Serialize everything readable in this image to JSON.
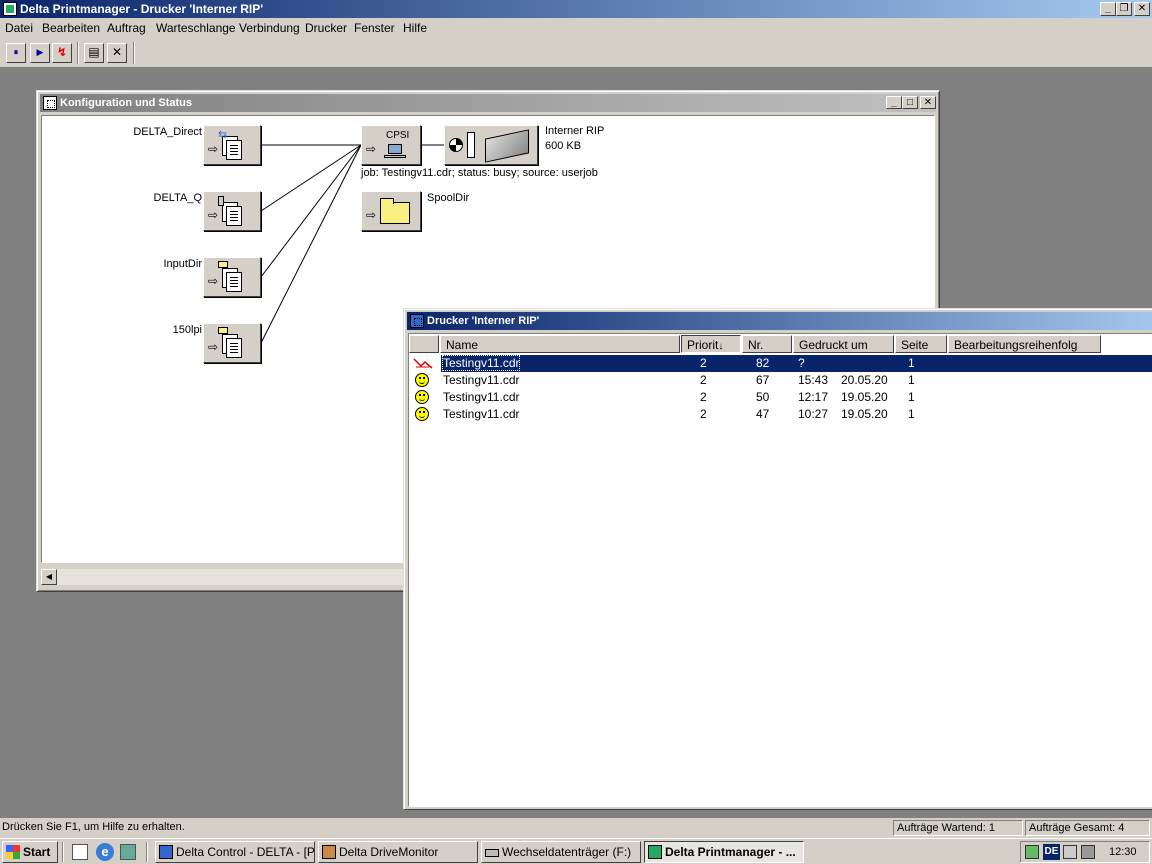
{
  "app": {
    "title": "Delta Printmanager - Drucker 'Interner RIP'"
  },
  "menu": [
    "Datei",
    "Bearbeiten",
    "Auftrag",
    "Warteschlange",
    "Verbindung",
    "Drucker",
    "Fenster",
    "Hilfe"
  ],
  "toolbar": {
    "pause": "⏸",
    "play": "▶",
    "stop": "↯",
    "list": "▤",
    "close": "✕"
  },
  "config_window": {
    "title": "Konfiguration und Status",
    "sources": [
      "DELTA_Direct",
      "DELTA_Q",
      "InputDir",
      "150lpi"
    ],
    "cpsi_label": "CPSI",
    "printer_name": "Interner RIP",
    "printer_memory": "600 KB",
    "job_status": "job: Testingv11.cdr; status: busy; source: userjob",
    "spool_label": "SpoolDir"
  },
  "printer_window": {
    "title": "Drucker 'Interner RIP'",
    "columns": [
      "Name",
      "Priorit",
      "Nr.",
      "Gedruckt um",
      "Seite",
      "Bearbeitungsreihenfolg"
    ],
    "sort_indicator": "↓",
    "jobs": [
      {
        "name": "Testingv11.cdr",
        "prio": "2",
        "nr": "82",
        "time": "?",
        "date": "",
        "page": "1",
        "status_icon": "busy-icon"
      },
      {
        "name": "Testingv11.cdr",
        "prio": "2",
        "nr": "67",
        "time": "15:43",
        "date": "20.05.20",
        "page": "1",
        "status_icon": "smiley-icon"
      },
      {
        "name": "Testingv11.cdr",
        "prio": "2",
        "nr": "50",
        "time": "12:17",
        "date": "19.05.20",
        "page": "1",
        "status_icon": "smiley-icon"
      },
      {
        "name": "Testingv11.cdr",
        "prio": "2",
        "nr": "47",
        "time": "10:27",
        "date": "19.05.20",
        "page": "1",
        "status_icon": "smiley-icon"
      }
    ]
  },
  "statusbar": {
    "help": "Drücken Sie F1, um Hilfe zu erhalten.",
    "waiting": "Aufträge Wartend: 1",
    "total": "Aufträge Gesamt: 4"
  },
  "taskbar": {
    "start": "Start",
    "tasks": [
      "Delta Control - DELTA - [P...",
      "Delta DriveMonitor",
      "Wechseldatenträger (F:)",
      "Delta Printmanager - ..."
    ],
    "lang": "DE",
    "clock": "12:30"
  },
  "colors": {
    "title_active": "#0a246a",
    "title_inactive": "#808080",
    "face": "#d4d0c8",
    "selection": "#0a246a",
    "folder": "#f8f080"
  }
}
